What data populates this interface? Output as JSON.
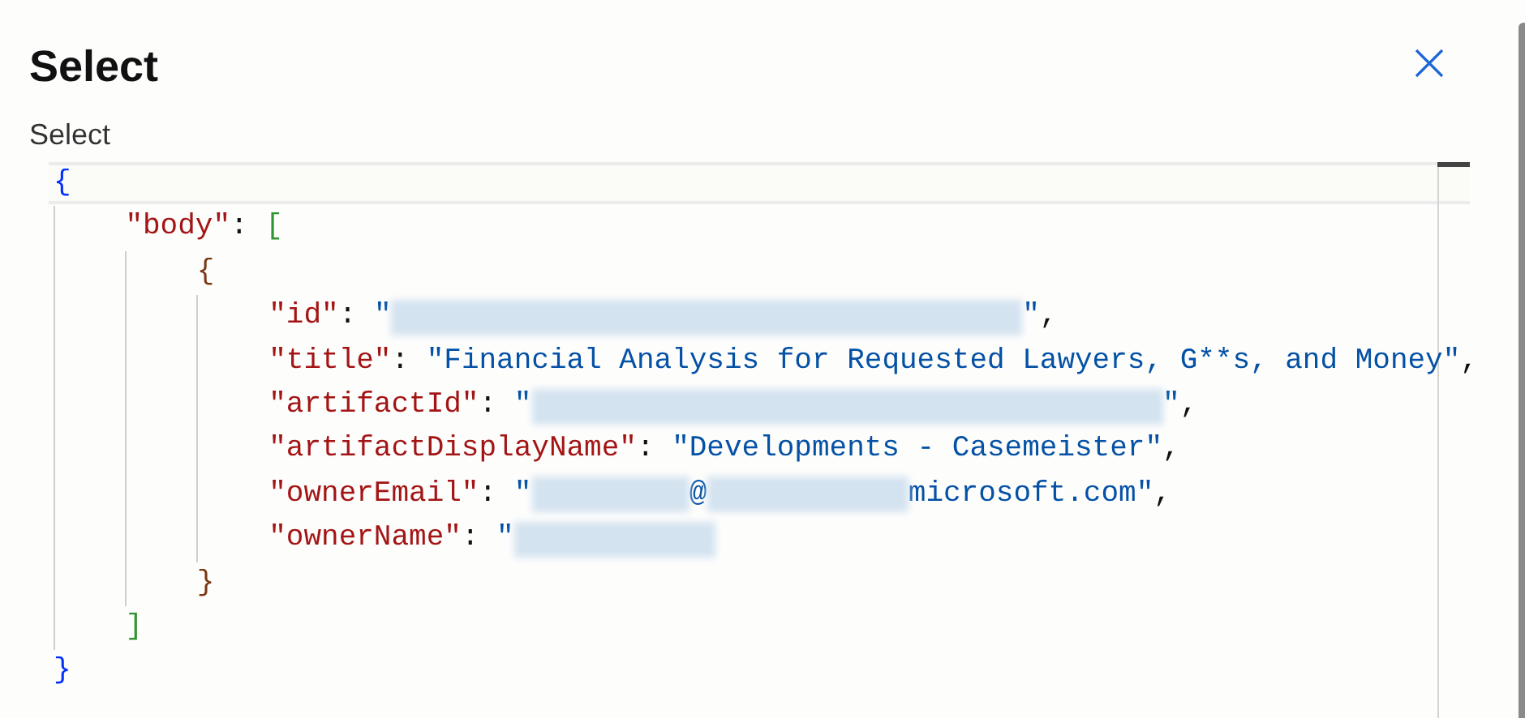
{
  "dialog": {
    "title": "Select",
    "field_label": "Select"
  },
  "editor": {
    "root": {
      "open": [
        {
          "kind": "bracket",
          "text": "{",
          "color": "#0431fa"
        }
      ],
      "close": [
        {
          "kind": "bracket",
          "text": "}",
          "color": "#0431fa"
        }
      ],
      "children": [
        {
          "open": [
            {
              "kind": "key",
              "text": "\"body\""
            },
            {
              "kind": "punct",
              "text": ": "
            },
            {
              "kind": "bracket",
              "text": "[",
              "color": "#319331"
            }
          ],
          "close": [
            {
              "kind": "bracket",
              "text": "]",
              "color": "#319331"
            }
          ],
          "children": [
            {
              "open": [
                {
                  "kind": "bracket",
                  "text": "{",
                  "color": "#7b3814"
                }
              ],
              "close": [
                {
                  "kind": "bracket",
                  "text": "}",
                  "color": "#7b3814"
                }
              ],
              "children": [
                {
                  "open": [
                    {
                      "kind": "key",
                      "text": "\"id\""
                    },
                    {
                      "kind": "punct",
                      "text": ": "
                    },
                    {
                      "kind": "string",
                      "text": "\""
                    },
                    {
                      "kind": "redacted_long"
                    },
                    {
                      "kind": "string",
                      "text": "\""
                    },
                    {
                      "kind": "punct",
                      "text": ","
                    }
                  ]
                },
                {
                  "open": [
                    {
                      "kind": "key",
                      "text": "\"title\""
                    },
                    {
                      "kind": "punct",
                      "text": ": "
                    },
                    {
                      "kind": "string",
                      "text": "\"Financial Analysis for Requested Lawyers, G**s, and Money\""
                    },
                    {
                      "kind": "punct",
                      "text": ","
                    }
                  ]
                },
                {
                  "open": [
                    {
                      "kind": "key",
                      "text": "\"artifactId\""
                    },
                    {
                      "kind": "punct",
                      "text": ": "
                    },
                    {
                      "kind": "string",
                      "text": "\""
                    },
                    {
                      "kind": "redacted_long"
                    },
                    {
                      "kind": "string",
                      "text": "\""
                    },
                    {
                      "kind": "punct",
                      "text": ","
                    }
                  ]
                },
                {
                  "open": [
                    {
                      "kind": "key",
                      "text": "\"artifactDisplayName\""
                    },
                    {
                      "kind": "punct",
                      "text": ": "
                    },
                    {
                      "kind": "string",
                      "text": "\"Developments - Casemeister\""
                    },
                    {
                      "kind": "punct",
                      "text": ","
                    }
                  ]
                },
                {
                  "open": [
                    {
                      "kind": "key",
                      "text": "\"ownerEmail\""
                    },
                    {
                      "kind": "punct",
                      "text": ": "
                    },
                    {
                      "kind": "string",
                      "text": "\""
                    },
                    {
                      "kind": "redacted_short"
                    },
                    {
                      "kind": "string",
                      "text": "@"
                    },
                    {
                      "kind": "redacted_medium"
                    },
                    {
                      "kind": "string",
                      "text": "microsoft.com\""
                    },
                    {
                      "kind": "punct",
                      "text": ","
                    }
                  ]
                },
                {
                  "open": [
                    {
                      "kind": "key",
                      "text": "\"ownerName\""
                    },
                    {
                      "kind": "punct",
                      "text": ": "
                    },
                    {
                      "kind": "string",
                      "text": "\""
                    },
                    {
                      "kind": "redacted_medium"
                    }
                  ]
                }
              ]
            }
          ]
        }
      ]
    }
  }
}
